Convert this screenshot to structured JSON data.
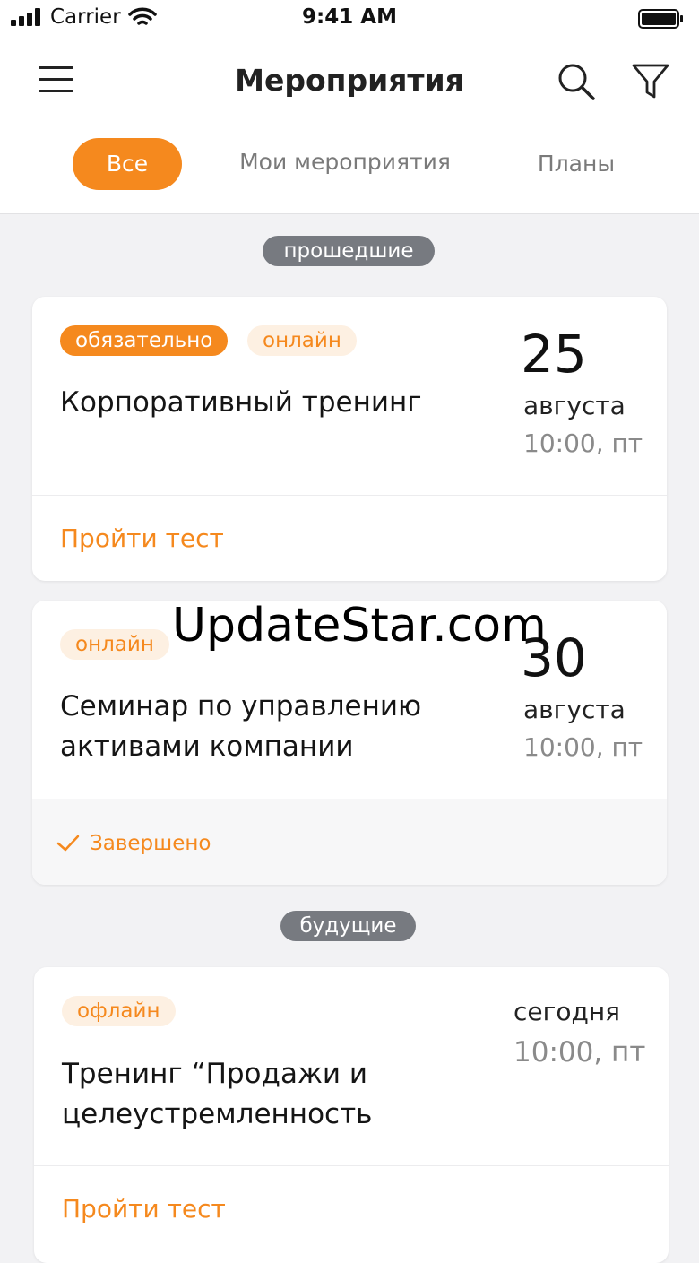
{
  "status_bar": {
    "carrier": "Carrier",
    "time": "9:41 AM"
  },
  "header": {
    "title": "Мероприятия",
    "tabs": [
      {
        "label": "Все",
        "active": true
      },
      {
        "label": "Мои мероприятия",
        "active": false
      },
      {
        "label": "Планы",
        "active": false
      }
    ]
  },
  "sections": {
    "past": "прошедшие",
    "future": "будущие"
  },
  "events": [
    {
      "badges": [
        "обязательно",
        "онлайн"
      ],
      "title": "Корпоративный тренинг",
      "day": "25",
      "month": "августа",
      "time": "10:00, пт",
      "action": "Пройти тест"
    },
    {
      "badges": [
        "онлайн"
      ],
      "title": "Семинар по управлению активами компании",
      "day": "30",
      "month": "августа",
      "time": "10:00, пт",
      "status": "Завершено"
    },
    {
      "badges": [
        "офлайн"
      ],
      "title": "Тренинг “Продажи и целеустремленность",
      "day_label": "сегодня",
      "time": "10:00, пт",
      "action": "Пройти тест"
    }
  ],
  "watermark": "UpdateStar.com",
  "colors": {
    "accent": "#f5891e",
    "accent_soft": "#fdf0e2",
    "pill": "#777a80",
    "background": "#f2f2f4"
  },
  "icons": [
    "menu-icon",
    "search-icon",
    "filter-icon",
    "check-icon",
    "signal-icon",
    "wifi-icon",
    "battery-icon"
  ]
}
